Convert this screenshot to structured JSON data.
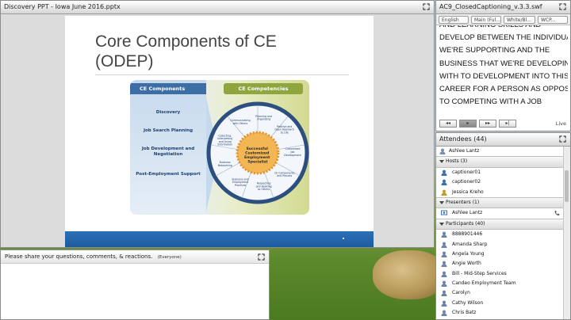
{
  "share_pod": {
    "title": "Discovery PPT - Iowa June 2016.pptx",
    "slide": {
      "title": "Core Components of CE (ODEP)",
      "diagram": {
        "left_header": "CE Components",
        "right_header": "CE Competencies",
        "components": [
          "Discovery",
          "Job Search Planning",
          "Job Development and Negotiation",
          "Post-Employment Support"
        ],
        "center": "Successful Customized Employment Specialist",
        "competencies": [
          "Planning and Organizing",
          "Positive and Open Approach to Life",
          "Customized Job Development",
          "CE Components and Process",
          "Respecting and Relating to Others",
          "Business and Employment Practices",
          "Business Networking",
          "Collecting, Interpreting and Using Information",
          "Communicating with Others"
        ]
      }
    }
  },
  "caption_pod": {
    "title": "AC9_ClosedCaptioning_v.3.3.swf",
    "tabs": [
      "English",
      "Main (Ful...",
      "White/Bl...",
      "WCP..."
    ],
    "lines": [
      "AND LEARNING SKILLS AND",
      "DEVELOP BETWEEN THE INDIVIDUAL",
      "WE'RE SUPPORTING AND THE",
      "BUSINESS THAT WE'RE DEVELOPING",
      "WITH TO DEVELOPMENT INTO THIS",
      "CAREER FOR A PERSON AS OPPOSED",
      "TO COMPETING WITH A JOB"
    ],
    "controls": [
      "◂◂",
      "▸",
      "▸▸",
      "▸|"
    ],
    "status": "Live"
  },
  "attendees_pod": {
    "title": "Attendees",
    "count": "(44)",
    "self": "Ashlee Lantz",
    "hosts": {
      "label": "Hosts (3)",
      "names": [
        "captioner01",
        "captioner02",
        "Jessica Kreho"
      ]
    },
    "presenters": {
      "label": "Presenters (1)",
      "names": [
        "Ashlee Lantz"
      ]
    },
    "participants": {
      "label": "Participants (40)",
      "names": [
        "8888901446",
        "Amanda Sharp",
        "Angela Young",
        "Angie Worth",
        "Bill - Mid-Step Services",
        "Candeo Employment Team",
        "Carolyn",
        "Cathy Wilson",
        "Chris Batz"
      ]
    }
  },
  "chat_pod": {
    "prompt": "Please share your questions, comments, & reactions.",
    "audience": "(Everyone)"
  }
}
